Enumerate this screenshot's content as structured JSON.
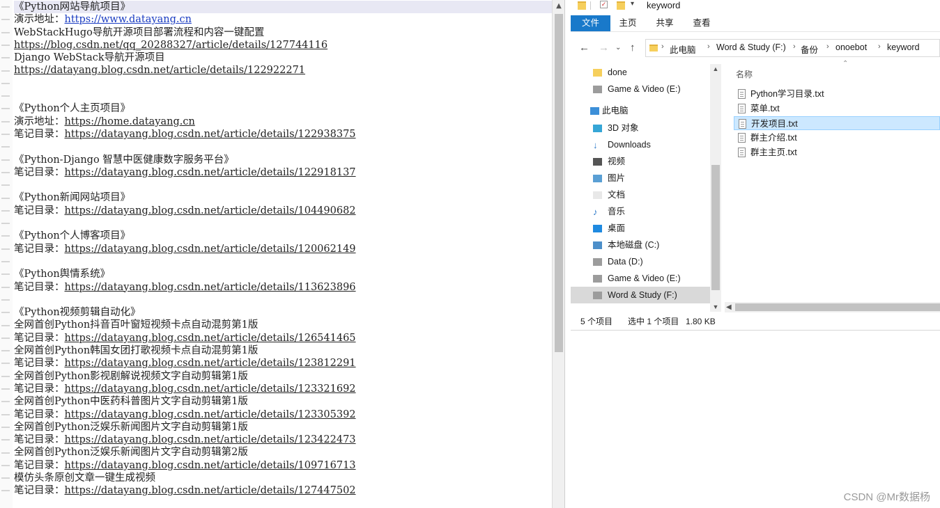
{
  "editor": {
    "lines": [
      {
        "label": "《Python网站导航项目》"
      },
      {
        "label": "演示地址：",
        "url": "https://www.datayang.cn",
        "blue": true
      },
      {
        "label": "WebStackHugo导航开源项目部署流程和内容一键配置"
      },
      {
        "url": "https://blog.csdn.net/qq_20288327/article/details/127744116"
      },
      {
        "label": "Django WebStack导航开源项目"
      },
      {
        "url": "https://datayang.blog.csdn.net/article/details/122922271"
      },
      {
        "label": ""
      },
      {
        "label": ""
      },
      {
        "label": "《Python个人主页项目》"
      },
      {
        "label": "演示地址：",
        "url": "https://home.datayang.cn"
      },
      {
        "label": "笔记目录：",
        "url": "https://datayang.blog.csdn.net/article/details/122938375"
      },
      {
        "label": ""
      },
      {
        "label": "《Python-Django 智慧中医健康数字服务平台》"
      },
      {
        "label": "笔记目录：",
        "url": "https://datayang.blog.csdn.net/article/details/122918137"
      },
      {
        "label": ""
      },
      {
        "label": "《Python新闻网站项目》"
      },
      {
        "label": "笔记目录：",
        "url": "https://datayang.blog.csdn.net/article/details/104490682"
      },
      {
        "label": ""
      },
      {
        "label": "《Python个人博客项目》"
      },
      {
        "label": "笔记目录：",
        "url": "https://datayang.blog.csdn.net/article/details/120062149"
      },
      {
        "label": ""
      },
      {
        "label": "《Python舆情系统》"
      },
      {
        "label": "笔记目录：",
        "url": "https://datayang.blog.csdn.net/article/details/113623896"
      },
      {
        "label": ""
      },
      {
        "label": "《Python视频剪辑自动化》"
      },
      {
        "label": "全网首创Python抖音百叶窗短视频卡点自动混剪第1版"
      },
      {
        "label": "笔记目录：",
        "url": "https://datayang.blog.csdn.net/article/details/126541465"
      },
      {
        "label": "全网首创Python韩国女团打歌视频卡点自动混剪第1版"
      },
      {
        "label": "笔记目录：",
        "url": "https://datayang.blog.csdn.net/article/details/123812291"
      },
      {
        "label": "全网首创Python影视剧解说视频文字自动剪辑第1版"
      },
      {
        "label": "笔记目录：",
        "url": "https://datayang.blog.csdn.net/article/details/123321692"
      },
      {
        "label": "全网首创Python中医药科普图片文字自动剪辑第1版"
      },
      {
        "label": "笔记目录：",
        "url": "https://datayang.blog.csdn.net/article/details/123305392"
      },
      {
        "label": "全网首创Python泛娱乐新闻图片文字自动剪辑第1版"
      },
      {
        "label": "笔记目录：",
        "url": "https://datayang.blog.csdn.net/article/details/123422473"
      },
      {
        "label": "全网首创Python泛娱乐新闻图片文字自动剪辑第2版"
      },
      {
        "label": "笔记目录：",
        "url": "https://datayang.blog.csdn.net/article/details/109716713"
      },
      {
        "label": "模仿头条原创文章一键生成视频"
      },
      {
        "label": "笔记目录：",
        "url": "https://datayang.blog.csdn.net/article/details/127447502"
      }
    ],
    "scroll_up_icon": "chevron-up-icon"
  },
  "explorer": {
    "window_title": "keyword",
    "ribbon_tabs": [
      "文件",
      "主页",
      "共享",
      "查看"
    ],
    "breadcrumb": [
      "此电脑",
      "Word & Study (F:)",
      "备份",
      "onoebot",
      "keyword"
    ],
    "nav_items": [
      {
        "label": "done",
        "icon": "folder-icon",
        "indent": 1,
        "selected": false
      },
      {
        "label": "Game & Video (E:)",
        "icon": "drive-icon",
        "indent": 1,
        "selected": false
      },
      {
        "label": "此电脑",
        "icon": "computer-icon",
        "indent": 0,
        "selected": false
      },
      {
        "label": "3D 对象",
        "icon": "cube-3d-icon",
        "indent": 1,
        "selected": false
      },
      {
        "label": "Downloads",
        "icon": "download-icon",
        "indent": 1,
        "selected": false
      },
      {
        "label": "视频",
        "icon": "video-icon",
        "indent": 1,
        "selected": false
      },
      {
        "label": "图片",
        "icon": "picture-icon",
        "indent": 1,
        "selected": false
      },
      {
        "label": "文档",
        "icon": "document-icon",
        "indent": 1,
        "selected": false
      },
      {
        "label": "音乐",
        "icon": "music-icon",
        "indent": 1,
        "selected": false
      },
      {
        "label": "桌面",
        "icon": "desktop-icon",
        "indent": 1,
        "selected": false
      },
      {
        "label": "本地磁盘 (C:)",
        "icon": "system-drive-icon",
        "indent": 1,
        "selected": false
      },
      {
        "label": "Data (D:)",
        "icon": "drive-icon",
        "indent": 1,
        "selected": false
      },
      {
        "label": "Game & Video (E:)",
        "icon": "drive-icon",
        "indent": 1,
        "selected": false
      },
      {
        "label": "Word & Study (F:)",
        "icon": "drive-icon",
        "indent": 1,
        "selected": true
      }
    ],
    "column_header": "名称",
    "files": [
      {
        "name": "Python学习目录.txt",
        "selected": false
      },
      {
        "name": "菜单.txt",
        "selected": false
      },
      {
        "name": "开发项目.txt",
        "selected": true
      },
      {
        "name": "群主介绍.txt",
        "selected": false
      },
      {
        "name": "群主主页.txt",
        "selected": false
      }
    ],
    "status": {
      "count": "5 个项目",
      "selection": "选中 1 个项目",
      "size": "1.80 KB"
    }
  },
  "watermark": "CSDN @Mr数据杨",
  "colors": {
    "accent": "#1979ca",
    "selection": "#cce8ff",
    "link_blue": "#1a3cc2"
  }
}
